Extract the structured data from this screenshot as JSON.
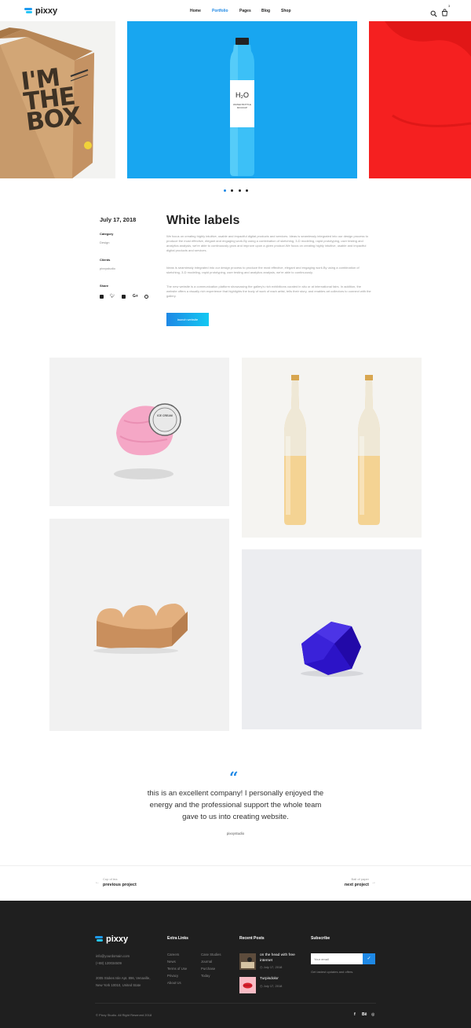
{
  "header": {
    "logo": "pixxy",
    "nav": [
      {
        "label": "Home",
        "active": false
      },
      {
        "label": "Portfolio",
        "active": true
      },
      {
        "label": "Pages",
        "active": false
      },
      {
        "label": "Blog",
        "active": false
      },
      {
        "label": "Shop",
        "active": false
      }
    ],
    "cart_count": "3"
  },
  "carousel": {
    "slide_1_text": "I'M THE BOX",
    "slide_2_label_main": "H₂O",
    "slide_2_label_sub": "WATER BOTTLE MOCKUP",
    "dots": 4,
    "active_dot": 1
  },
  "project": {
    "date": "July 17, 2018",
    "title": "White labels",
    "category_label": "Category",
    "category_value": "Design",
    "clients_label": "Clients",
    "clients_value": "pixxystudio",
    "share_label": "Share",
    "paragraphs": [
      "We focus on creating highly intuitive, usable and impactful digital products and services. Ideas is seamlessly integrated into our design process to produce the most effective, elegant and engaging work.By using a combination of sketching, 3-D modeling, rapid prototyping, user testing and analytics analysis, we're able to continuously grow and improve upon a given product.We focus on creating highly intuitive, usable and impactful digital products and services.",
      "Ideas is seamlessly integrated into our design process to produce the most effective, elegant and engaging work.By using a combination of sketching, 3-D modeling, rapid prototyping, user testing and analytics analysis, we're able to continuously.",
      "The new website is a communication platform showcasing the gallery's rich exhibitions curated in situ or at international fairs. In addition, the website offers a visually rich experience that highlights the body of work of each artist, tells their story, and enables art collectors to connect with the gallery."
    ],
    "launch_label": "launch website",
    "stamp_text": "ICE CREAM"
  },
  "testimonial": {
    "text": "this is an excellent company! I personally enjoyed the energy and the professional support the whole team gave to us into creating website.",
    "author": "pixxystudio"
  },
  "project_nav": {
    "prev_small": "Cup of tea",
    "prev_label": "previous project",
    "next_small": "Ball of paper",
    "next_label": "next project"
  },
  "footer": {
    "logo": "pixxy",
    "email": "info@yourdomain.com",
    "phone": "(+88) 120034509",
    "address_1": "2005 Stokes Isle Apt. 896, Venaville,",
    "address_2": "New York 10010, United State",
    "extra_links_title": "Extra Links",
    "links_col1": [
      "Careers",
      "News",
      "Terms of Use",
      "Privacy",
      "About Us"
    ],
    "links_col2": [
      "Case Studies",
      "Journal",
      "Purchase",
      "Today"
    ],
    "recent_posts_title": "Recent Posts",
    "posts": [
      {
        "title": "on the head with free internet",
        "date": "July 17, 2018"
      },
      {
        "title": "Turpisdolor",
        "date": "July 17, 2018"
      }
    ],
    "subscribe_title": "Subscribe",
    "email_placeholder": "Your email",
    "subscribe_note": "Get lastest updates and offers.",
    "copyright": "© Pixxy Studio. All Right Reserved 2018",
    "social": [
      "f",
      "Bē",
      "◎"
    ]
  },
  "colors": {
    "accent": "#1e88e5",
    "slide_blue": "#18a6f0",
    "slide_red": "#f52020",
    "footer_bg": "#1f1f1f"
  }
}
